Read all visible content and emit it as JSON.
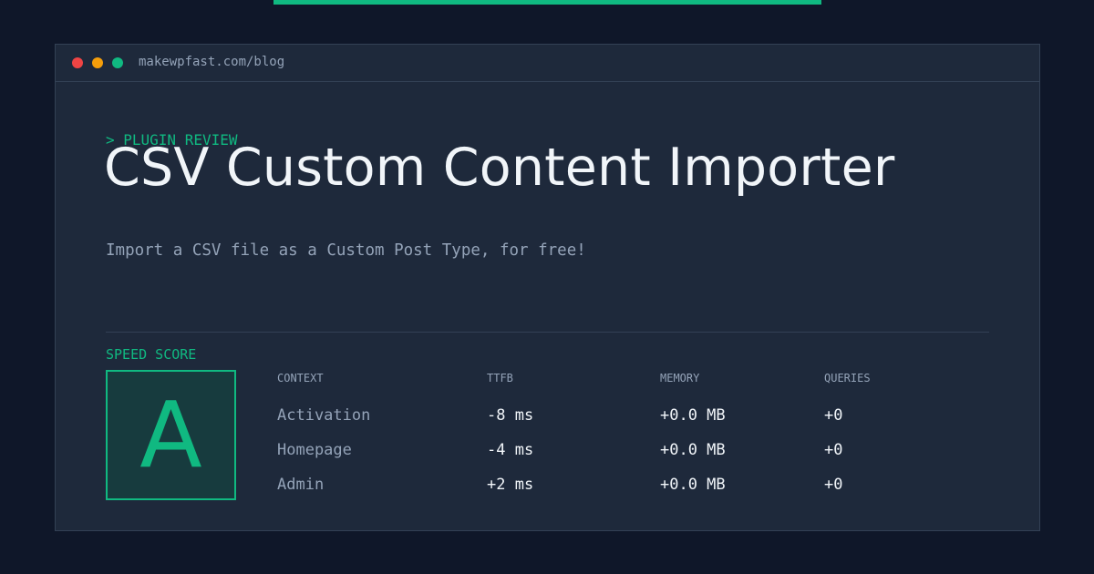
{
  "colors": {
    "background": "#0f1729",
    "accent": "#10b981",
    "window": "#1e293b",
    "dot_red": "#ef4444",
    "dot_yellow": "#f59e0b",
    "dot_green": "#10b981"
  },
  "window": {
    "url": "makewpfast.com/blog"
  },
  "post": {
    "kicker": "> PLUGIN REVIEW",
    "title": "CSV Custom Content Importer",
    "subtitle": "Import a CSV file as a Custom Post Type, for free!"
  },
  "score": {
    "label": "SPEED SCORE",
    "grade": "A"
  },
  "table": {
    "headers": {
      "context": "CONTEXT",
      "ttfb": "TTFB",
      "memory": "MEMORY",
      "queries": "QUERIES"
    },
    "rows": [
      {
        "context": "Activation",
        "ttfb": "-8 ms",
        "memory": "+0.0 MB",
        "queries": "+0"
      },
      {
        "context": "Homepage",
        "ttfb": "-4 ms",
        "memory": "+0.0 MB",
        "queries": "+0"
      },
      {
        "context": "Admin",
        "ttfb": "+2 ms",
        "memory": "+0.0 MB",
        "queries": "+0"
      }
    ]
  },
  "icons": {
    "close": "close-dot-icon",
    "minimize": "minimize-dot-icon",
    "maximize": "maximize-dot-icon"
  }
}
